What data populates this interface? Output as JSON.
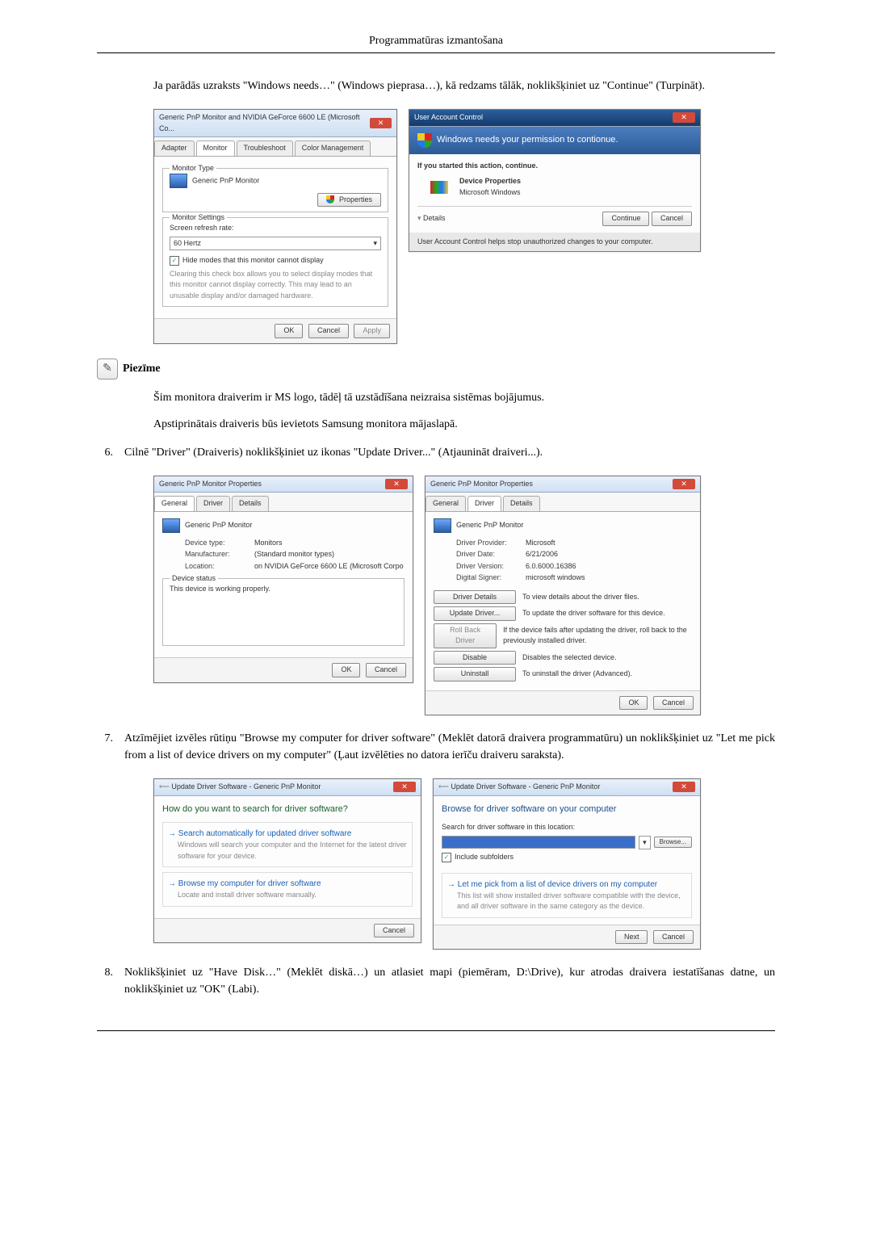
{
  "header": "Programmatūras izmantošana",
  "intro_para": "Ja parādās uzraksts \"Windows needs…\" (Windows pieprasa…), kā redzams tālāk, noklikšķiniet uz \"Continue\" (Turpināt).",
  "win1": {
    "title": "Generic PnP Monitor and NVIDIA GeForce 6600 LE (Microsoft Co...",
    "tabs": {
      "adapter": "Adapter",
      "monitor": "Monitor",
      "troubleshoot": "Troubleshoot",
      "color": "Color Management"
    },
    "monitor_type_label": "Monitor Type",
    "monitor_name": "Generic PnP Monitor",
    "properties_btn": "Properties",
    "settings_label": "Monitor Settings",
    "refresh_label": "Screen refresh rate:",
    "refresh_value": "60 Hertz",
    "hide_label": "Hide modes that this monitor cannot display",
    "hide_desc": "Clearing this check box allows you to select display modes that this monitor cannot display correctly. This may lead to an unusable display and/or damaged hardware.",
    "ok": "OK",
    "cancel": "Cancel",
    "apply": "Apply"
  },
  "uac": {
    "title": "User Account Control",
    "heading": "Windows needs your permission to contionue.",
    "subheading": "If you started this action, continue.",
    "prog": "Device Properties",
    "vendor": "Microsoft Windows",
    "details": "Details",
    "continue": "Continue",
    "cancel": "Cancel",
    "footer": "User Account Control helps stop unauthorized changes to your computer."
  },
  "note": {
    "label": "Piezīme",
    "line1": "Šim monitora draiverim ir MS logo, tādēļ tā uzstādīšana neizraisa sistēmas bojājumus.",
    "line2": "Apstiprinātais draiveris būs ievietots Samsung monitora mājaslapā."
  },
  "step6": {
    "no": "6.",
    "text": "Cilnē \"Driver\" (Draiveris) noklikšķiniet uz ikonas \"Update Driver...\" (Atjaunināt draiveri...)."
  },
  "props_general": {
    "title": "Generic PnP Monitor Properties",
    "tabs": {
      "general": "General",
      "driver": "Driver",
      "details": "Details"
    },
    "name": "Generic PnP Monitor",
    "devtype_k": "Device type:",
    "devtype_v": "Monitors",
    "manu_k": "Manufacturer:",
    "manu_v": "(Standard monitor types)",
    "loc_k": "Location:",
    "loc_v": "on NVIDIA GeForce 6600 LE (Microsoft Corpo",
    "status_label": "Device status",
    "status_text": "This device is working properly.",
    "ok": "OK",
    "cancel": "Cancel"
  },
  "props_driver": {
    "title": "Generic PnP Monitor Properties",
    "tabs": {
      "general": "General",
      "driver": "Driver",
      "details": "Details"
    },
    "name": "Generic PnP Monitor",
    "prov_k": "Driver Provider:",
    "prov_v": "Microsoft",
    "date_k": "Driver Date:",
    "date_v": "6/21/2006",
    "ver_k": "Driver Version:",
    "ver_v": "6.0.6000.16386",
    "sign_k": "Digital Signer:",
    "sign_v": "microsoft windows",
    "b_details": "Driver Details",
    "b_details_d": "To view details about the driver files.",
    "b_update": "Update Driver...",
    "b_update_d": "To update the driver software for this device.",
    "b_roll": "Roll Back Driver",
    "b_roll_d": "If the device fails after updating the driver, roll back to the previously installed driver.",
    "b_disable": "Disable",
    "b_disable_d": "Disables the selected device.",
    "b_uninstall": "Uninstall",
    "b_uninstall_d": "To uninstall the driver (Advanced).",
    "ok": "OK",
    "cancel": "Cancel"
  },
  "step7": {
    "no": "7.",
    "text": "Atzīmējiet izvēles rūtiņu \"Browse my computer for driver software\" (Meklēt datorā draivera programmatūru) un noklikšķiniet uz \"Let me pick from a list of device drivers on my computer\" (Ļaut izvēlēties no datora ierīču draiveru saraksta)."
  },
  "wiz1": {
    "title": "Update Driver Software - Generic PnP Monitor",
    "heading": "How do you want to search for driver software?",
    "opt1": "Search automatically for updated driver software",
    "opt1d": "Windows will search your computer and the Internet for the latest driver software for your device.",
    "opt2": "Browse my computer for driver software",
    "opt2d": "Locate and install driver software manually.",
    "cancel": "Cancel"
  },
  "wiz2": {
    "title": "Update Driver Software - Generic PnP Monitor",
    "heading": "Browse for driver software on your computer",
    "loc_label": "Search for driver software in this location:",
    "browse": "Browse...",
    "include": "Include subfolders",
    "pick": "Let me pick from a list of device drivers on my computer",
    "pickd": "This list will show installed driver software compatible with the device, and all driver software in the same category as the device.",
    "next": "Next",
    "cancel": "Cancel"
  },
  "step8": {
    "no": "8.",
    "text": "Noklikšķiniet uz \"Have Disk…\" (Meklēt diskā…) un atlasiet mapi (piemēram, D:\\Drive), kur atrodas draivera iestatīšanas datne, un noklikšķiniet uz \"OK\" (Labi)."
  }
}
